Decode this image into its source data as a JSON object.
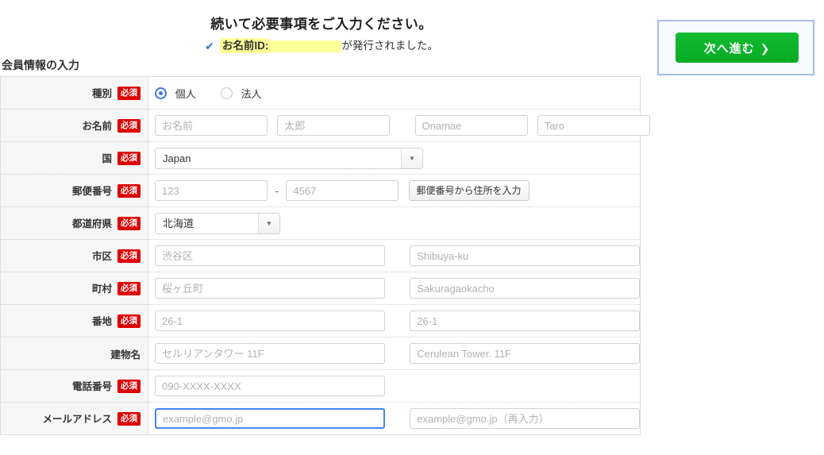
{
  "header": {
    "headline": "続いて必要事項をご入力ください。",
    "check_icon": "✔",
    "id_label": "お名前ID:",
    "id_suffix": "が発行されました。",
    "section_title": "会員情報の入力"
  },
  "next_button": {
    "label": "次へ進む",
    "chevron": "❯",
    "color": "#0cb52c",
    "focus_border_color": "#a8bbe8"
  },
  "badge": {
    "label": "必須",
    "color": "#dd0000"
  },
  "form": {
    "rows": {
      "type": {
        "label": "種別",
        "options": [
          {
            "label": "個人",
            "selected": true
          },
          {
            "label": "法人",
            "selected": false
          }
        ]
      },
      "name": {
        "label": "お名前",
        "placeholders": [
          "お名前",
          "太郎",
          "Onamae",
          "Taro"
        ]
      },
      "country": {
        "label": "国",
        "value": "Japan",
        "arrow": "▼"
      },
      "zip": {
        "label": "郵便番号",
        "placeholder_1": "123",
        "dash": "-",
        "placeholder_2": "4567",
        "lookup_button": "郵便番号から住所を入力"
      },
      "prefecture": {
        "label": "都道府県",
        "value": "北海道",
        "arrow": "▼"
      },
      "city": {
        "label": "市区",
        "placeholder_ja": "渋谷区",
        "placeholder_en": "Shibuya-ku"
      },
      "town": {
        "label": "町村",
        "placeholder_ja": "桜ヶ丘町",
        "placeholder_en": "Sakuragaokacho"
      },
      "block": {
        "label": "番地",
        "placeholder_ja": "26-1",
        "placeholder_en": "26-1"
      },
      "building": {
        "label": "建物名",
        "placeholder_ja": "セルリアンタワー 11F",
        "placeholder_en": "Cerulean Tower. 11F"
      },
      "tel": {
        "label": "電話番号",
        "placeholder": "090-XXXX-XXXX"
      },
      "email": {
        "label": "メールアドレス",
        "placeholder": "example@gmo.jp",
        "placeholder_confirm": "example@gmo.jp（再入力）",
        "focused": true,
        "focus_color": "#4285f4"
      }
    }
  }
}
